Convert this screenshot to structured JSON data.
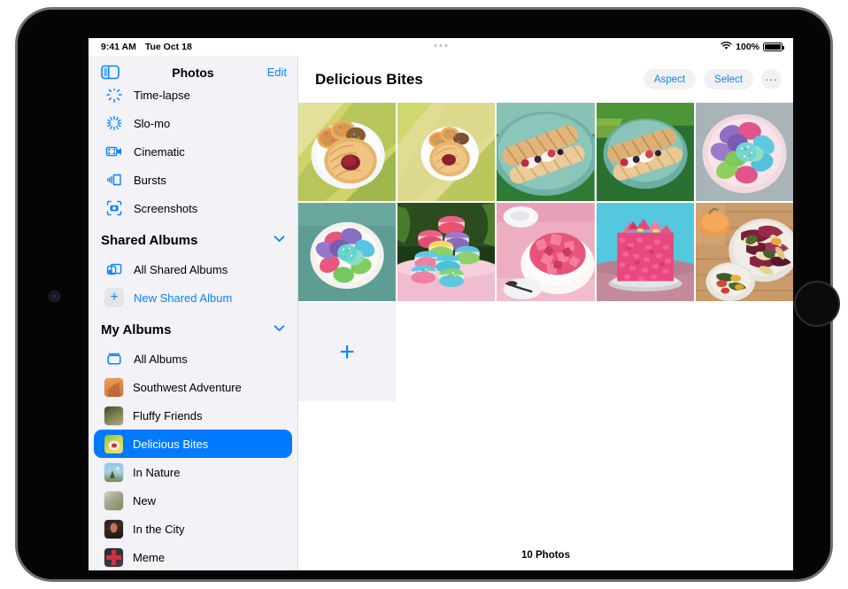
{
  "status_bar": {
    "time": "9:41 AM",
    "date": "Tue Oct 18",
    "battery_percent": "100%",
    "wifi_icon": "wifi-icon",
    "battery_icon": "battery-icon",
    "multitask_handle_icon": "multitask-handle-icon"
  },
  "sidebar": {
    "title": "Photos",
    "edit_label": "Edit",
    "toggle_icon": "sidebar-toggle-icon",
    "media_types": [
      {
        "label": "Time-lapse",
        "icon": "time-lapse-icon"
      },
      {
        "label": "Slo-mo",
        "icon": "slo-mo-icon"
      },
      {
        "label": "Cinematic",
        "icon": "cinematic-icon"
      },
      {
        "label": "Bursts",
        "icon": "bursts-icon"
      },
      {
        "label": "Screenshots",
        "icon": "screenshots-icon"
      }
    ],
    "shared_albums": {
      "header": "Shared Albums",
      "chevron_icon": "chevron-down-icon",
      "items": [
        {
          "label": "All Shared Albums",
          "icon": "shared-albums-icon",
          "accent": false
        },
        {
          "label": "New Shared Album",
          "icon": "plus-icon",
          "accent": true
        }
      ]
    },
    "my_albums": {
      "header": "My Albums",
      "chevron_icon": "chevron-down-icon",
      "items": [
        {
          "label": "All Albums",
          "icon": "all-albums-icon",
          "selected": false
        },
        {
          "label": "Southwest Adventure",
          "icon": "album-thumbnail",
          "selected": false
        },
        {
          "label": "Fluffy Friends",
          "icon": "album-thumbnail",
          "selected": false
        },
        {
          "label": "Delicious Bites",
          "icon": "album-thumbnail",
          "selected": true
        },
        {
          "label": "In Nature",
          "icon": "album-thumbnail",
          "selected": false
        },
        {
          "label": "New",
          "icon": "album-thumbnail",
          "selected": false
        },
        {
          "label": "In the City",
          "icon": "album-thumbnail",
          "selected": false
        },
        {
          "label": "Meme",
          "icon": "album-thumbnail",
          "selected": false
        }
      ]
    }
  },
  "detail": {
    "album_title": "Delicious Bites",
    "toolbar": {
      "aspect_label": "Aspect",
      "select_label": "Select",
      "more_label": "···",
      "more_icon": "ellipsis-icon"
    },
    "photos": [
      {
        "name": "danish-pastries-sprinkle-cookies-white-plate"
      },
      {
        "name": "danish-pastry-sprinkle-cookies-round-plate"
      },
      {
        "name": "churro-eclairs-berries-teal-plate"
      },
      {
        "name": "churro-eclair-fruit-topping-teal-plate"
      },
      {
        "name": "pastel-macarons-flower-arrangement-pink-plate"
      },
      {
        "name": "pastel-macarons-white-plate-teal-background"
      },
      {
        "name": "stacked-colorful-macarons-pink-table"
      },
      {
        "name": "pink-strawberry-cake-slice-pink-cloth"
      },
      {
        "name": "pink-frosted-layer-cake-teal-background"
      },
      {
        "name": "roasted-vegetable-radicchio-platter-wood-table"
      }
    ],
    "add_button": {
      "icon": "plus-icon",
      "label": "+"
    },
    "footer_count": "10 Photos"
  },
  "colors": {
    "accent": "#0a84ff",
    "selection": "#007aff",
    "sidebar_bg": "#f2f2f7",
    "pill_bg": "#f1f1f4"
  }
}
